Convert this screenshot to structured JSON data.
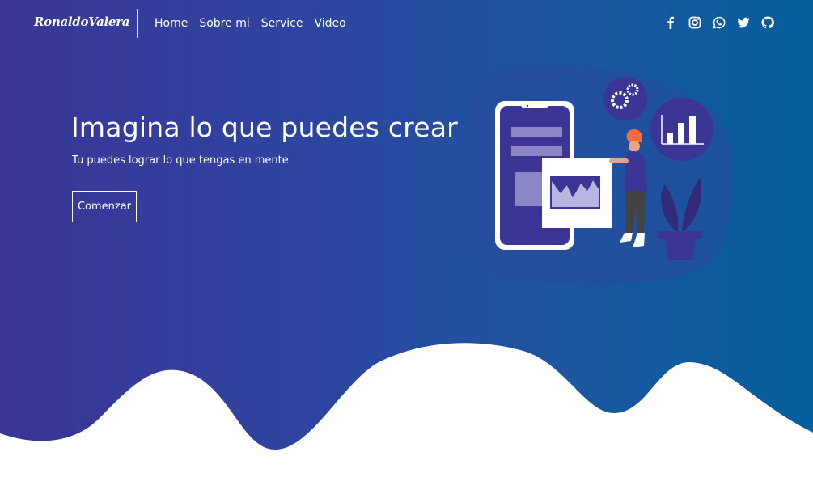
{
  "brand": "RonaldoValera",
  "nav": {
    "items": [
      {
        "label": "Home"
      },
      {
        "label": "Sobre mi"
      },
      {
        "label": "Service"
      },
      {
        "label": "Video"
      }
    ]
  },
  "social": [
    "facebook-icon",
    "instagram-icon",
    "whatsapp-icon",
    "twitter-icon",
    "github-icon"
  ],
  "hero": {
    "title": "Imagina lo que puedes crear",
    "subtitle": "Tu puedes lograr lo que tengas en mente",
    "button_label": "Comenzar"
  },
  "colors": {
    "gradient_start": "#3b3596",
    "gradient_end": "#055f9c",
    "text": "#ffffff",
    "wave": "#ffffff"
  }
}
